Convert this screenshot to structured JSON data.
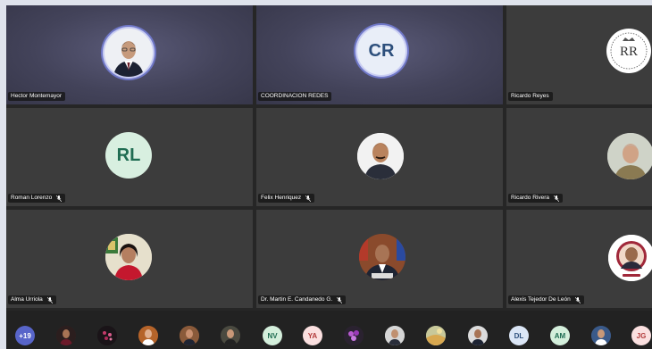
{
  "tiles": [
    {
      "name": "Hector Montemayor",
      "mic_muted": false,
      "avatar": "photo-man-suit-icon"
    },
    {
      "name": "COORDINACION REDES",
      "mic_muted": false,
      "initials": "CR",
      "avatar_color": "#e9eef8"
    },
    {
      "name": "Ricardo Reyes",
      "mic_muted": false,
      "avatar": "rr-monogram-logo"
    },
    {
      "name": "Roman Lorenzo",
      "mic_muted": true,
      "initials": "RL",
      "avatar_color": "#d8efe0"
    },
    {
      "name": "Felix Henriquez",
      "mic_muted": true,
      "avatar": "photo-man-mustache-icon"
    },
    {
      "name": "Ricardo Rivera",
      "mic_muted": true,
      "avatar": "photo-man-gray-hair-icon"
    },
    {
      "name": "Alma Urriola",
      "mic_muted": true,
      "avatar": "photo-woman-red-icon"
    },
    {
      "name": "Dr. Martin E. Candanedo G.",
      "mic_muted": true,
      "avatar": "photo-man-flags-icon"
    },
    {
      "name": "Alexis Tejedor De León",
      "mic_muted": true,
      "avatar": "photo-man-circle-icon"
    }
  ],
  "strip": {
    "overflow_count": "+19",
    "initials_chips": [
      {
        "label": "NV",
        "bg": "#d4efdc",
        "fg": "#1f6c52"
      },
      {
        "label": "YA",
        "bg": "#fbe0e0",
        "fg": "#b23a3a"
      },
      {
        "label": "DL",
        "bg": "#dbe6f6",
        "fg": "#2d4f7c"
      },
      {
        "label": "AM",
        "bg": "#d4efdc",
        "fg": "#1f6c52"
      },
      {
        "label": "JG",
        "bg": "#fbe0e0",
        "fg": "#b23a3a"
      }
    ]
  },
  "colors": {
    "stage": "#262626",
    "tile": "#3c3c3c",
    "active_tile": "#43435a",
    "overflow_chip": "#5865c9"
  }
}
